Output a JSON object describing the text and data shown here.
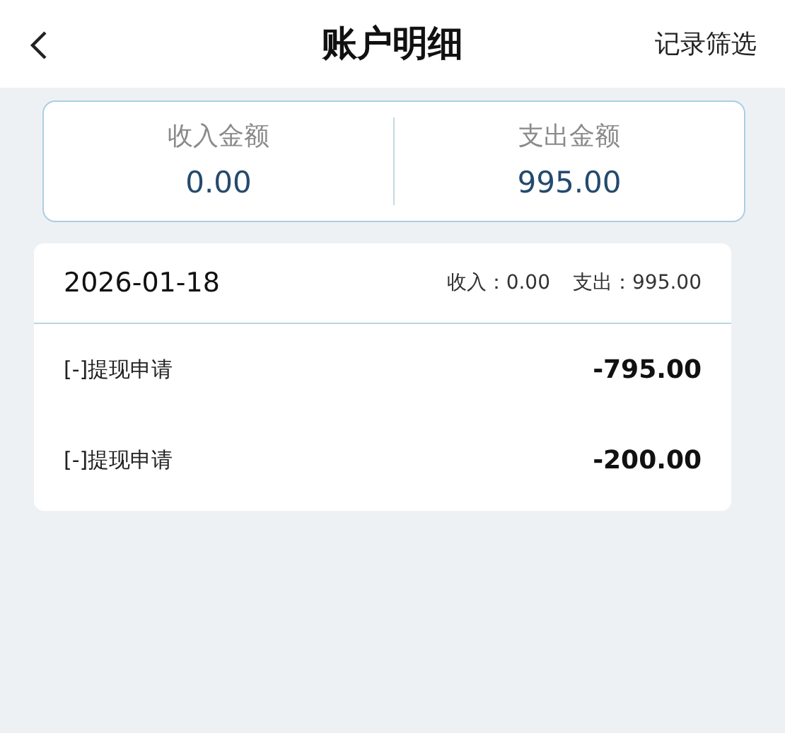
{
  "header": {
    "title": "账户明细",
    "action": "记录筛选"
  },
  "summary": [
    {
      "label": "收入金额",
      "amount": "0.00"
    },
    {
      "label": "支出金额",
      "amount": "995.00"
    }
  ],
  "days": [
    {
      "date": "2026-01-18",
      "totals": [
        "收入：0.00",
        "支出：995.00"
      ],
      "records": [
        {
          "title": "[-]提现申请",
          "amount": "-795.00"
        },
        {
          "title": "[-]提现申请",
          "amount": "-200.00"
        }
      ]
    }
  ]
}
